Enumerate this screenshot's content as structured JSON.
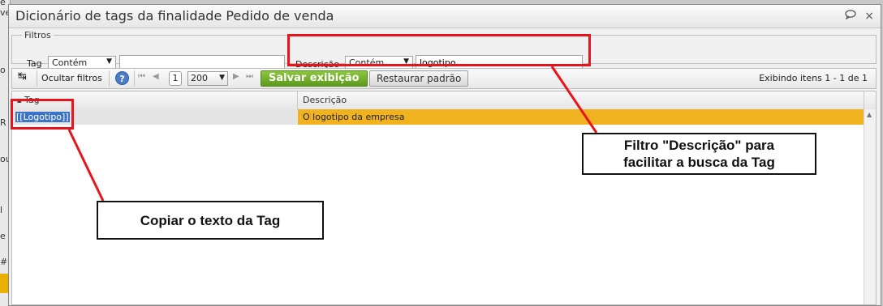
{
  "background": {
    "fragments": [
      "e venda",
      "o",
      "R",
      "ou",
      "l",
      "e",
      "#"
    ]
  },
  "window": {
    "title": "Dicionário de tags da finalidade Pedido de venda",
    "icons": [
      "chat-bubble-icon",
      "close-icon"
    ],
    "close_glyph": "×",
    "chat_glyph": "💬"
  },
  "filters": {
    "legend": "Filtros",
    "tag_label": "Tag",
    "tag_operator": "Contém",
    "tag_value": "",
    "descricao_label": "Descrição",
    "descricao_operator": "Contém",
    "descricao_value": "logotipo"
  },
  "toolbar": {
    "hide_filters": "Ocultar filtros",
    "help_glyph": "?",
    "current_page": "1",
    "per_page": "200",
    "save_view": "Salvar exibição",
    "restore_default": "Restaurar padrão",
    "items_count": "Exibindo itens 1 - 1 de 1"
  },
  "grid": {
    "columns": [
      "▴ Tag",
      "Descrição"
    ],
    "rows": [
      {
        "tag": "[[Logotipo]]",
        "descricao": "O logotipo da empresa"
      }
    ],
    "highlight_color": "#f0b31f",
    "selection_color": "#3a73c8"
  },
  "annotations": {
    "copy_tag": "Copiar o texto da Tag",
    "filter_desc_line1": "Filtro \"Descrição\" para",
    "filter_desc_line2": "facilitar a busca da Tag",
    "color": "#e8141b"
  }
}
